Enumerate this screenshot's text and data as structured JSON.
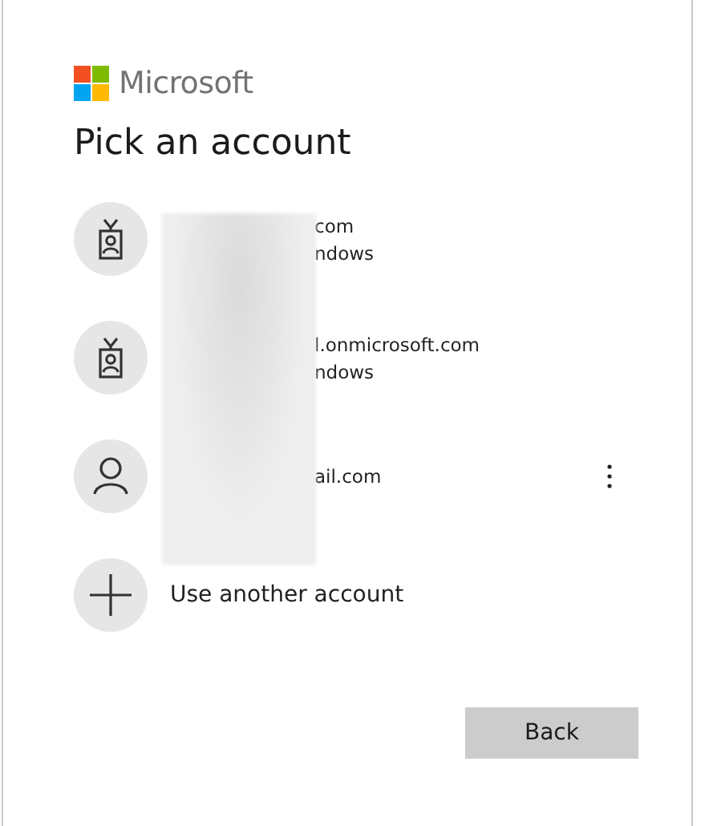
{
  "brand": {
    "name": "Microsoft"
  },
  "title": "Pick an account",
  "accounts": [
    {
      "kind": "badge",
      "lines": [
        "com",
        "ndows"
      ],
      "menu": false
    },
    {
      "kind": "badge",
      "lines": [
        "l.onmicrosoft.com",
        "ndows"
      ],
      "menu": false
    },
    {
      "kind": "person",
      "lines": [
        "ail.com"
      ],
      "menu": true
    }
  ],
  "add_account": {
    "label": "Use another account"
  },
  "buttons": [
    {
      "label": "Back"
    }
  ]
}
